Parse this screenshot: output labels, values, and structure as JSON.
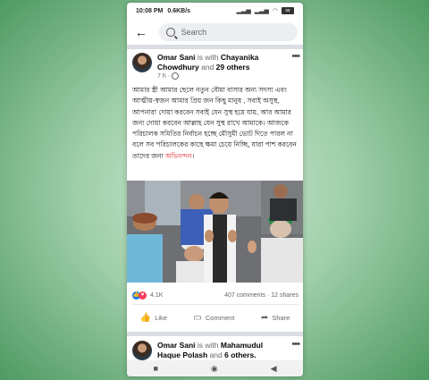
{
  "status_bar": {
    "time": "10:08 PM",
    "speed": "0.6KB/s",
    "battery": "58"
  },
  "search": {
    "placeholder": "Search"
  },
  "post1": {
    "author": "Omar Sani",
    "with_text": " is with ",
    "tagged": "Chayanika Chowdhury",
    "and_text": " and ",
    "others": "29 others",
    "time": "7 h · ",
    "text_main": "আমার স্ত্রী আমার ছেলে নতুন বৌমা বাসার অন্য সদস্য এবং আত্মীয়-স্বজন আমার প্রিয় জন কিছু মানুষ , সবাই অসুস্থ, আপনারা দোয়া করবেন সবাই যেন সুস্থ হয়ে যায়, আর আমার জন্য দোয়া করবেন আল্লাহ যেন সুস্থ রাখে আমাকে। আজকে পরিচালক সমিতির নির্বাচন হচ্ছে মৌসুমী ভোট দিতে পারল না বলে সব পরিচালকের কাছে ক্ষমা চেয়ে নিচ্ছি, যারা পাশ করবেন তাদের জন্য ",
    "text_highlight": "অভিনন্দন",
    "text_end": "।",
    "reactions_count": "4.1K",
    "comments": "407 comments",
    "shares": " · 12 shares",
    "like": "Like",
    "comment": "Comment",
    "share": "Share"
  },
  "post2": {
    "author": "Omar Sani",
    "with_text": " is with ",
    "tagged": "Mahamudul Haque Polash",
    "and_text": " and ",
    "others": "6 others."
  },
  "navbar": {
    "square": "■",
    "circle": "◉",
    "back": "◀"
  }
}
